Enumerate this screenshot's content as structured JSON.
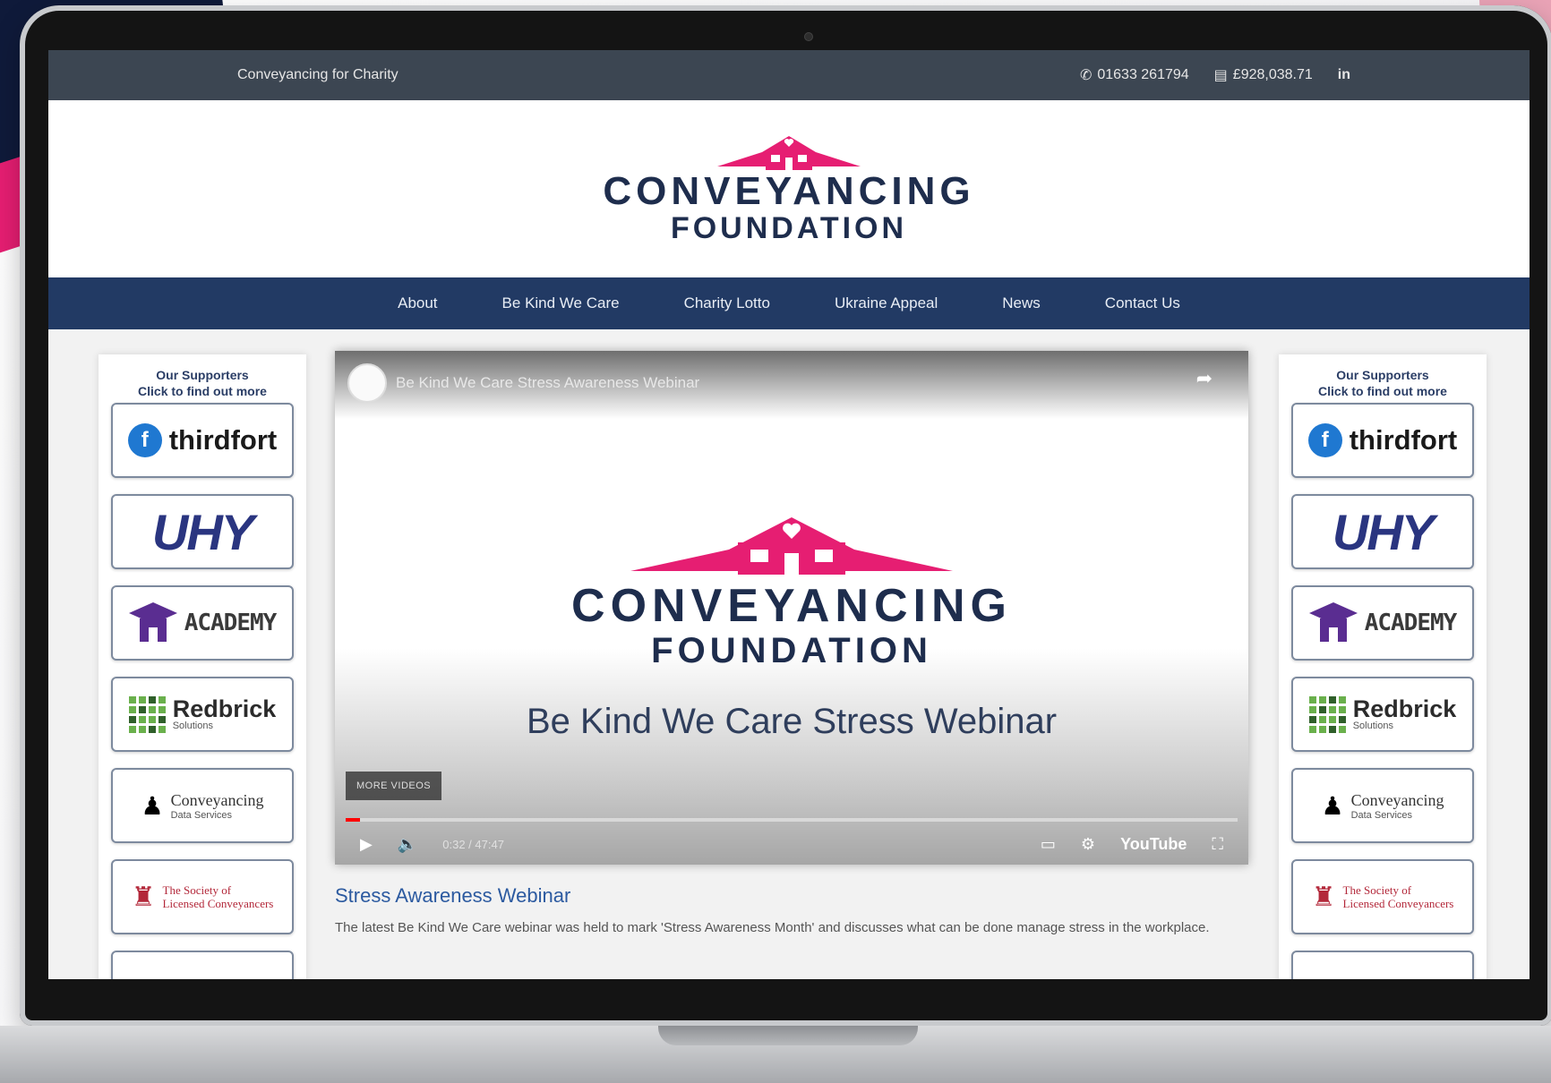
{
  "topbar": {
    "tagline": "Conveyancing for Charity",
    "phone": "01633 261794",
    "raised": "£928,038.71",
    "social": "in"
  },
  "logo": {
    "line1": "CONVEYANCING",
    "line2": "FOUNDATION",
    "brand_pink": "#e61e72",
    "brand_navy": "#1e2d4d"
  },
  "nav": {
    "items": [
      "About",
      "Be Kind We Care",
      "Charity Lotto",
      "Ukraine Appeal",
      "News",
      "Contact Us"
    ],
    "background": "#223a64"
  },
  "sidebar": {
    "title_line1": "Our Supporters",
    "title_line2": "Click to find out more",
    "sponsors": {
      "thirdfort": "thirdfort",
      "uhy": "UHY",
      "academy": "ACADEMY",
      "redbrick": "Redbrick",
      "redbrick_sub": "Solutions",
      "cds": "Conveyancing",
      "cds_sub": "Data Services",
      "slc_line1": "The Society of",
      "slc_line2": "Licensed Conveyancers"
    }
  },
  "video": {
    "title": "Be Kind We Care Stress Awareness Webinar",
    "logo_line1": "CONVEYANCING",
    "logo_line2": "FOUNDATION",
    "subtitle": "Be Kind We Care Stress Webinar",
    "more_videos": "MORE VIDEOS",
    "time": "0:32 / 47:47",
    "youtube": "YouTube",
    "progress": 0.016
  },
  "post": {
    "title": "Stress Awareness Webinar",
    "body": "The latest Be Kind We Care webinar was held to mark 'Stress Awareness Month' and discusses what can be done manage stress in the workplace."
  }
}
